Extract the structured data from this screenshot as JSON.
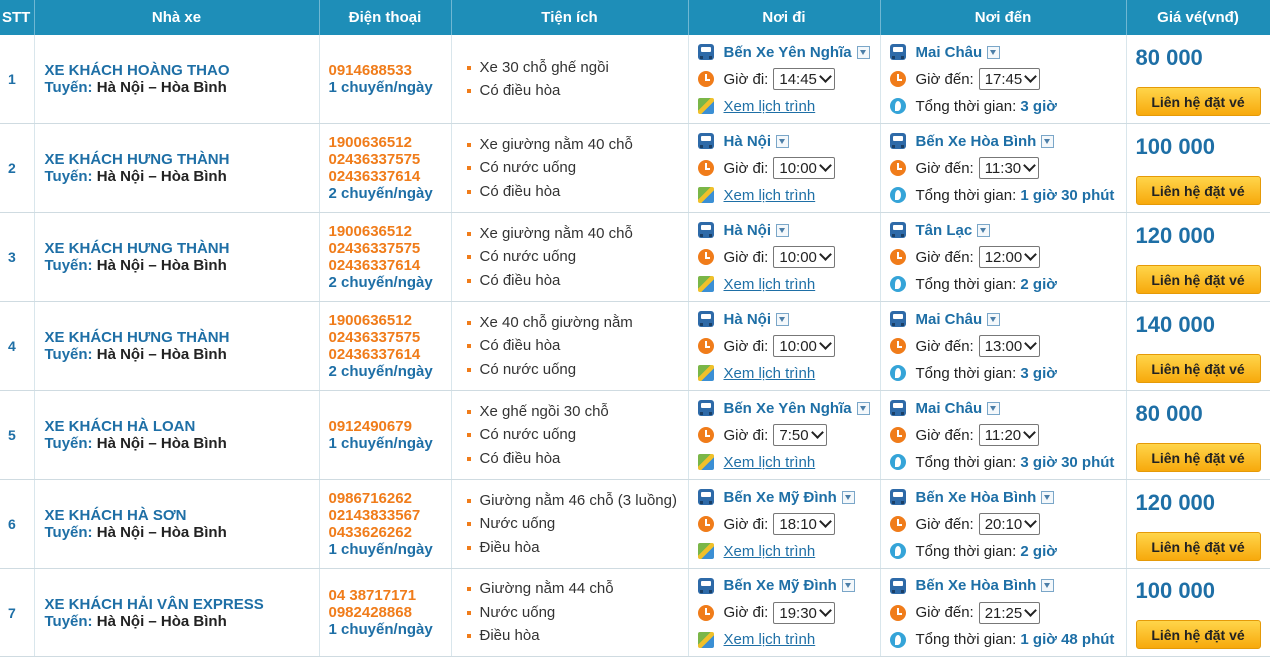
{
  "headers": {
    "stt": "STT",
    "company": "Nhà xe",
    "phone": "Điện thoại",
    "amenities": "Tiện ích",
    "from": "Nơi đi",
    "to": "Nơi đến",
    "price": "Giá vé(vnđ)"
  },
  "labels": {
    "route_label": "Tuyến:",
    "depart_label": "Giờ đi:",
    "arrive_label": "Giờ đến:",
    "schedule_link": "Xem lịch trình",
    "total_label": "Tổng thời gian:",
    "book_button": "Liên hệ đặt vé"
  },
  "rows": [
    {
      "stt": "1",
      "name": "XE KHÁCH HOÀNG THAO",
      "route": "Hà Nội – Hòa Bình",
      "phones": [
        "0914688533"
      ],
      "freq": "1 chuyến/ngày",
      "amenities": [
        "Xe 30 chỗ ghế ngồi",
        "Có điều hòa"
      ],
      "from": "Bến Xe Yên Nghĩa",
      "depart": "14:45",
      "to": "Mai Châu",
      "arrive": "17:45",
      "total": "3 giờ",
      "price": "80 000"
    },
    {
      "stt": "2",
      "name": "XE KHÁCH HƯNG THÀNH",
      "route": "Hà Nội – Hòa Bình",
      "phones": [
        "1900636512",
        "02436337575",
        "02436337614"
      ],
      "freq": "2 chuyến/ngày",
      "amenities": [
        "Xe giường nằm 40 chỗ",
        "Có nước uống",
        "Có điều hòa"
      ],
      "from": "Hà Nội",
      "depart": "10:00",
      "to": "Bến Xe Hòa Bình",
      "arrive": "11:30",
      "total": "1 giờ 30 phút",
      "price": "100 000"
    },
    {
      "stt": "3",
      "name": "XE KHÁCH HƯNG THÀNH",
      "route": "Hà Nội – Hòa Bình",
      "phones": [
        "1900636512",
        "02436337575",
        "02436337614"
      ],
      "freq": "2 chuyến/ngày",
      "amenities": [
        "Xe giường nằm 40 chỗ",
        "Có nước uống",
        "Có điều hòa"
      ],
      "from": "Hà Nội",
      "depart": "10:00",
      "to": "Tân Lạc",
      "arrive": "12:00",
      "total": "2 giờ",
      "price": "120 000"
    },
    {
      "stt": "4",
      "name": "XE KHÁCH HƯNG THÀNH",
      "route": "Hà Nội – Hòa Bình",
      "phones": [
        "1900636512",
        "02436337575",
        "02436337614"
      ],
      "freq": "2 chuyến/ngày",
      "amenities": [
        "Xe 40 chỗ giường nằm",
        "Có điều hòa",
        "Có nước uống"
      ],
      "from": "Hà Nội",
      "depart": "10:00",
      "to": "Mai Châu",
      "arrive": "13:00",
      "total": "3 giờ",
      "price": "140 000"
    },
    {
      "stt": "5",
      "name": "XE KHÁCH HÀ LOAN",
      "route": "Hà Nội – Hòa Bình",
      "phones": [
        "0912490679"
      ],
      "freq": "1 chuyến/ngày",
      "amenities": [
        "Xe ghế ngồi 30 chỗ",
        "Có nước uống",
        "Có điều hòa"
      ],
      "from": "Bến Xe Yên Nghĩa",
      "depart": "7:50",
      "to": "Mai Châu",
      "arrive": "11:20",
      "total": "3 giờ 30 phút",
      "price": "80 000"
    },
    {
      "stt": "6",
      "name": "XE KHÁCH HÀ SƠN",
      "route": "Hà Nội – Hòa Bình",
      "phones": [
        "0986716262",
        "02143833567",
        "0433626262"
      ],
      "freq": "1 chuyến/ngày",
      "amenities": [
        "Giường nằm 46 chỗ (3 luồng)",
        "Nước uống",
        "Điều hòa"
      ],
      "from": "Bến Xe Mỹ Đình",
      "depart": "18:10",
      "to": "Bến Xe Hòa Bình",
      "arrive": "20:10",
      "total": "2 giờ",
      "price": "120 000"
    },
    {
      "stt": "7",
      "name": "XE KHÁCH HẢI VÂN EXPRESS",
      "route": "Hà Nội – Hòa Bình",
      "phones": [
        "04 38717171",
        "0982428868"
      ],
      "freq": "1 chuyến/ngày",
      "amenities": [
        "Giường nằm 44 chỗ",
        "Nước uống",
        "Điều hòa"
      ],
      "from": "Bến Xe Mỹ Đình",
      "depart": "19:30",
      "to": "Bến Xe Hòa Bình",
      "arrive": "21:25",
      "total": "1 giờ 48 phút",
      "price": "100 000"
    }
  ]
}
